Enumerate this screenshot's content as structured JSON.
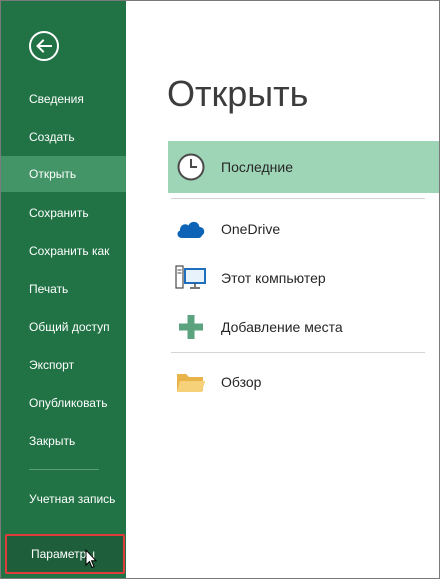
{
  "sidebar": {
    "items": [
      {
        "label": "Сведения"
      },
      {
        "label": "Создать"
      },
      {
        "label": "Открыть"
      },
      {
        "label": "Сохранить"
      },
      {
        "label": "Сохранить как"
      },
      {
        "label": "Печать"
      },
      {
        "label": "Общий доступ"
      },
      {
        "label": "Экспорт"
      },
      {
        "label": "Опубликовать"
      },
      {
        "label": "Закрыть"
      }
    ],
    "account_label": "Учетная запись",
    "options_label": "Параметры",
    "active": "Открыть"
  },
  "main": {
    "title": "Открыть",
    "locations": [
      {
        "label": "Последние",
        "icon": "clock-icon"
      },
      {
        "label": "OneDrive",
        "icon": "cloud-icon"
      },
      {
        "label": "Этот компьютер",
        "icon": "computer-icon"
      },
      {
        "label": "Добавление места",
        "icon": "plus-icon"
      },
      {
        "label": "Обзор",
        "icon": "folder-icon"
      }
    ]
  },
  "colors": {
    "sidebar_bg": "#217346",
    "sidebar_active": "#439467",
    "selected_location": "#9fd5b7",
    "highlight_border": "#e03c3c"
  }
}
